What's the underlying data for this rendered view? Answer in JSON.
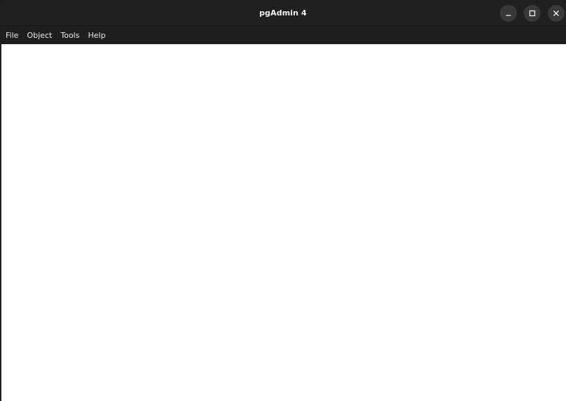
{
  "window": {
    "title": "pgAdmin 4",
    "controls": {
      "minimize": "minimize-icon",
      "maximize": "maximize-icon",
      "close": "close-icon"
    }
  },
  "menubar": {
    "items": [
      {
        "label": "File"
      },
      {
        "label": "Object"
      },
      {
        "label": "Tools"
      },
      {
        "label": "Help"
      }
    ]
  },
  "colors": {
    "titlebar_bg": "#202020",
    "menubar_bg": "#1e1e1e",
    "content_bg": "#ffffff",
    "button_bg": "#383838",
    "text": "#f2f2f2"
  }
}
